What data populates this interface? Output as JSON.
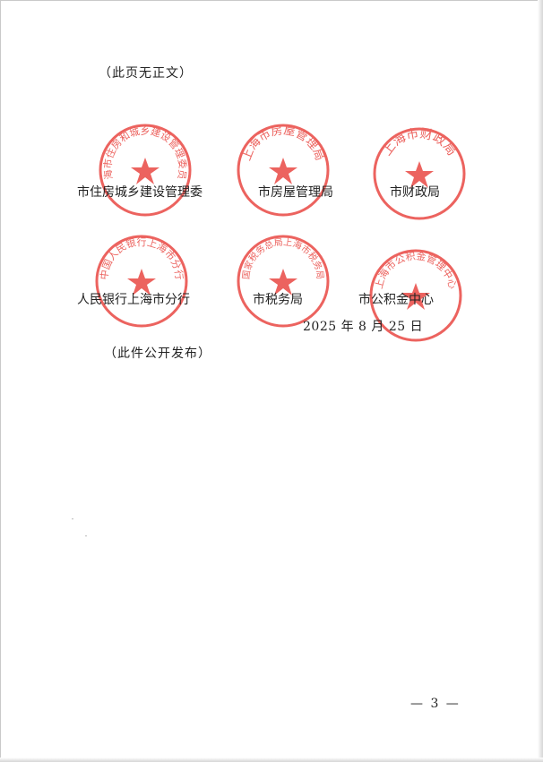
{
  "header_note": "（此页无正文）",
  "seals": [
    {
      "id": "seal-housing-urban-rural",
      "text": "上海市住房和城乡建设管理委员会"
    },
    {
      "id": "seal-housing-admin",
      "text": "上海市房屋管理局"
    },
    {
      "id": "seal-finance",
      "text": "上海市财政局"
    },
    {
      "id": "seal-pboc",
      "text": "中国人民银行上海市分行"
    },
    {
      "id": "seal-tax",
      "text": "国家税务总局上海市税务局"
    },
    {
      "id": "seal-provident-fund",
      "text": "上海市公积金管理中心"
    }
  ],
  "agencies_row1": [
    "市住房城乡建设管理委",
    "市房屋管理局",
    "市财政局"
  ],
  "agencies_row2": [
    "人民银行上海市分行",
    "市税务局",
    "市公积金中心"
  ],
  "date": "2025 年 8 月 25 日",
  "footer_note": "（此件公开发布）",
  "page_number": "— 3 —",
  "colors": {
    "seal_red": "#e8423c",
    "text": "#222222"
  }
}
